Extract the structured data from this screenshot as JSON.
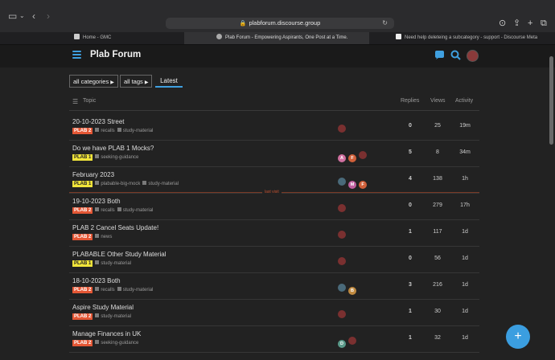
{
  "browser": {
    "url": "plabforum.discourse.group",
    "tabs": [
      {
        "label": "Home - GMC"
      },
      {
        "label": "Plab Forum - Empowering Aspirants, One Post at a Time."
      },
      {
        "label": "Need help deleteing a subcategory - support - Discourse Meta"
      }
    ]
  },
  "header": {
    "title": "Plab Forum"
  },
  "nav": {
    "all_categories": "all categories",
    "all_tags": "all tags",
    "latest": "Latest"
  },
  "columns": {
    "topic": "Topic",
    "replies": "Replies",
    "views": "Views",
    "activity": "Activity"
  },
  "last_visit_label": "last visit",
  "colors": {
    "plab2": "#e45735",
    "plab1": "#f0e43a",
    "accent": "#3fa0e0"
  },
  "topics": [
    {
      "title": "20-10-2023 Street",
      "badge": "PLAB 2",
      "tags": [
        "recalls",
        "study-material"
      ],
      "replies": "0",
      "views": "25",
      "activity": "19m"
    },
    {
      "title": "Do we have PLAB 1 Mocks?",
      "badge": "PLAB 1",
      "tags": [
        "seeking-guidance"
      ],
      "replies": "5",
      "views": "8",
      "activity": "34m"
    },
    {
      "title": "February 2023",
      "badge": "PLAB 1",
      "tags": [
        "plabable-big-mock",
        "study-material"
      ],
      "replies": "4",
      "views": "138",
      "activity": "1h"
    },
    {
      "title": "19-10-2023 Both",
      "badge": "PLAB 2",
      "tags": [
        "recalls",
        "study-material"
      ],
      "replies": "0",
      "views": "279",
      "activity": "17h"
    },
    {
      "title": "PLAB 2 Cancel Seats Update!",
      "badge": "PLAB 2",
      "tags": [
        "news"
      ],
      "replies": "1",
      "views": "117",
      "activity": "1d"
    },
    {
      "title": "PLABABLE Other Study Material",
      "badge": "PLAB 1",
      "tags": [
        "study-material"
      ],
      "replies": "0",
      "views": "56",
      "activity": "1d"
    },
    {
      "title": "18-10-2023 Both",
      "badge": "PLAB 2",
      "tags": [
        "recalls",
        "study-material"
      ],
      "replies": "3",
      "views": "216",
      "activity": "1d"
    },
    {
      "title": "Aspire Study Material",
      "badge": "PLAB 2",
      "tags": [
        "study-material"
      ],
      "replies": "1",
      "views": "30",
      "activity": "1d"
    },
    {
      "title": "Manage Finances in UK",
      "badge": "PLAB 2",
      "tags": [
        "seeking-guidance"
      ],
      "replies": "1",
      "views": "32",
      "activity": "1d"
    }
  ],
  "posters": [
    [
      {
        "letter": "",
        "color": "#7a3030"
      }
    ],
    [
      {
        "letter": "A",
        "color": "#d070a0"
      },
      {
        "letter": "F",
        "color": "#d0603a"
      },
      {
        "letter": "",
        "color": "#7a3030"
      }
    ],
    [
      {
        "letter": "",
        "color": "#4a6a7a"
      },
      {
        "letter": "M",
        "color": "#c060a0"
      },
      {
        "letter": "F",
        "color": "#d0603a"
      }
    ],
    [
      {
        "letter": "",
        "color": "#7a3030"
      }
    ],
    [
      {
        "letter": "",
        "color": "#7a3030"
      }
    ],
    [
      {
        "letter": "",
        "color": "#7a3030"
      }
    ],
    [
      {
        "letter": "",
        "color": "#4a6a7a"
      },
      {
        "letter": "B",
        "color": "#c08a40"
      }
    ],
    [
      {
        "letter": "",
        "color": "#7a3030"
      }
    ],
    [
      {
        "letter": "D",
        "color": "#5a9a8a"
      },
      {
        "letter": "",
        "color": "#7a3030"
      }
    ]
  ]
}
